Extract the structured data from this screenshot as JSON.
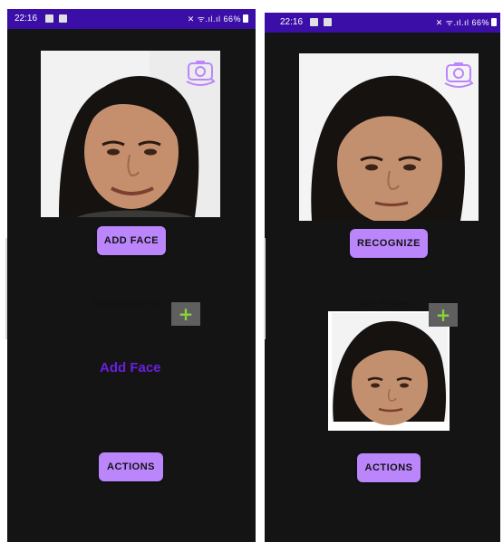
{
  "left_screen": {
    "status": {
      "time": "22:16",
      "right": "✕ ᯤ.ıl.ıl 66%"
    },
    "camera_flip_icon": "camera-flip-icon",
    "primary_button": "ADD FACE",
    "recognized_label": "Recognized Face",
    "add_square_symbol": "+",
    "add_face_text": "Add Face",
    "actions_button": "ACTIONS"
  },
  "right_screen": {
    "status": {
      "time": "22:16",
      "right": "✕ ᯤ.ıl.ıl 66%"
    },
    "camera_flip_icon": "camera-flip-icon",
    "primary_button": "RECOGNIZE",
    "face_preview_label": "Face Preview",
    "add_square_symbol": "+",
    "actions_button": "ACTIONS"
  },
  "colors": {
    "status_bar": "#3b0ea8",
    "background": "#141414",
    "button": "#bb86fc",
    "accent_text": "#6a1fe0",
    "plus": "#8bd33a"
  }
}
